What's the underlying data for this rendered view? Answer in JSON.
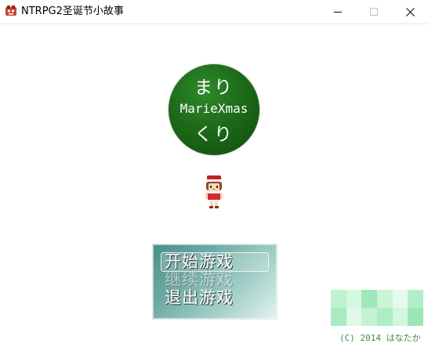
{
  "window": {
    "title": "NTRPG2圣诞节小故事",
    "app_icon": "rpg-maker-icon"
  },
  "logo": {
    "top_text": "まり",
    "middle_text": "MarieXmas",
    "bottom_text": "くり",
    "color": "#1d6a19"
  },
  "menu": {
    "items": [
      "开始游戏",
      "继续游戏",
      "退出游戏"
    ],
    "selected_index": 0,
    "disabled_index": 1
  },
  "copyright": "(C) 2014 はなたか",
  "colors": {
    "accent_green": "#3f8f3f",
    "menu_teal": "#6ba8a3"
  }
}
